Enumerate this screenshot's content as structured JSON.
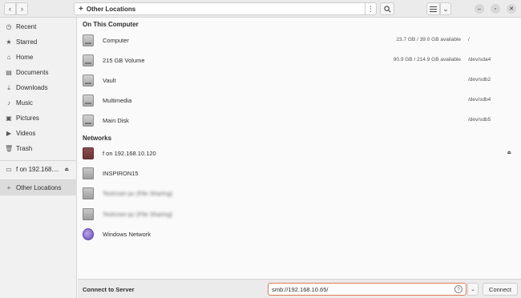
{
  "header": {
    "path_title": "Other Locations",
    "back_icon": "chevron-left",
    "forward_icon": "chevron-right",
    "new_icon": "plus",
    "menu_icon": "vertical-ellipsis",
    "search_icon": "magnifier",
    "view_icon": "list-view",
    "sort_icon": "chevron-down",
    "min_icon": "minus",
    "max_icon": "maximize",
    "close_icon": "close"
  },
  "sidebar": {
    "items": [
      {
        "label": "Recent",
        "icon": "clock"
      },
      {
        "label": "Starred",
        "icon": "star"
      },
      {
        "label": "Home",
        "icon": "home"
      },
      {
        "label": "Documents",
        "icon": "document"
      },
      {
        "label": "Downloads",
        "icon": "download"
      },
      {
        "label": "Music",
        "icon": "music-note"
      },
      {
        "label": "Pictures",
        "icon": "picture"
      },
      {
        "label": "Videos",
        "icon": "video"
      },
      {
        "label": "Trash",
        "icon": "trash"
      }
    ],
    "mounted": {
      "label": "f on 192.168....",
      "eject": "⏏"
    },
    "other_locations": {
      "label": "Other Locations",
      "icon": "plus"
    }
  },
  "computer_section": {
    "title": "On This Computer",
    "rows": [
      {
        "name": "Computer",
        "space": "23.7 GB / 39.0 GB available",
        "device": "/"
      },
      {
        "name": "215 GB Volume",
        "space": "90.9 GB / 214.9 GB available",
        "device": "/dev/sda4"
      },
      {
        "name": "Vault",
        "space": "",
        "device": "/dev/sdb2"
      },
      {
        "name": "Multimedia",
        "space": "",
        "device": "/dev/sdb4"
      },
      {
        "name": "Main Disk",
        "space": "",
        "device": "/dev/sdb5"
      }
    ]
  },
  "networks_section": {
    "title": "Networks",
    "rows": [
      {
        "name": "f on 192.168.10.120",
        "eject": "⏏"
      },
      {
        "name": "INSPIRON15"
      },
      {
        "name": "TestUser-pc (File Sharing)"
      },
      {
        "name": "TestUser-pc (File Sharing)"
      },
      {
        "name": "Windows Network"
      }
    ]
  },
  "bottom": {
    "label": "Connect to Server",
    "server_value": "smb://192.168.10.65/",
    "help": "?",
    "dropdown": "⌄",
    "connect_label": "Connect"
  },
  "colors": {
    "accent": "#e07b53",
    "sidebar_bg": "#f1f1f1",
    "header_bg": "#ebebeb"
  }
}
